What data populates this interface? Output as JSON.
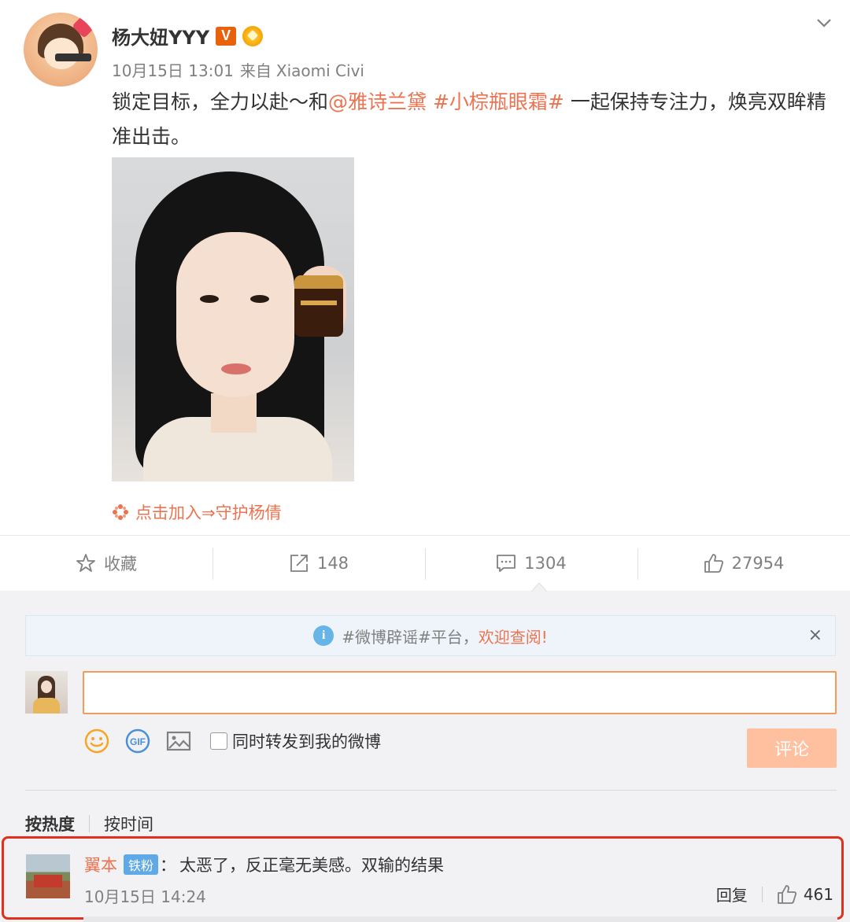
{
  "post": {
    "user_name": "杨大妞YYY",
    "verified_badge": "V",
    "timestamp": "10月15日 13:01",
    "source_prefix": "来自",
    "source_device": "Xiaomi Civi",
    "content": {
      "part1": "锁定目标，全力以赴～和",
      "mention": "@雅诗兰黛",
      "topic": "#小棕瓶眼霜#",
      "part2": " 一起保持专注力，焕亮双眸精准出击。"
    },
    "join_link": "点击加入⇒守护杨倩",
    "icons": [
      "avatar",
      "verified-badge",
      "medal-icon",
      "chevron-down-icon",
      "flower-icon"
    ]
  },
  "actions": {
    "favorite_label": "收藏",
    "repost_count": "148",
    "comment_count": "1304",
    "like_count": "27954"
  },
  "notice": {
    "topic": "#微博辟谣#平台，",
    "emphasis": "欢迎查阅!",
    "close": "×"
  },
  "composer": {
    "input_value": "",
    "forward_label": "同时转发到我的微博",
    "submit_label": "评论"
  },
  "sort": {
    "hot": "按热度",
    "time": "按时间"
  },
  "comments": [
    {
      "user": "翼本",
      "badge": "铁粉",
      "text": "太恶了，反正毫无美感。双输的结果",
      "time": "10月15日 14:24",
      "reply_label": "回复",
      "likes": "461"
    }
  ],
  "colors": {
    "accent": "#eb7350",
    "input_border": "#f29b5a",
    "submit_disabled": "#ffc09f",
    "highlight_border": "#e0301e",
    "fan_badge": "#5ea9e6"
  }
}
